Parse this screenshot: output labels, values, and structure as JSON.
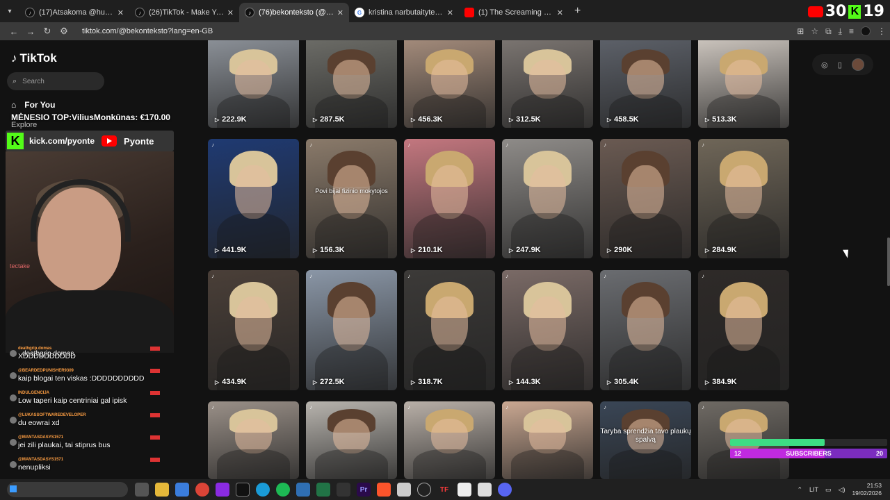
{
  "browser": {
    "tabs": [
      {
        "title": "(17)Atsakoma @hubert_0_0 #L...",
        "favicon": "tiktok-icon",
        "active": false
      },
      {
        "title": "(26)TikTok - Make Your Day",
        "favicon": "tiktok-icon",
        "active": false
      },
      {
        "title": "(76)bekonteksto (@bekontekst...",
        "favicon": "tiktok-icon",
        "active": true
      },
      {
        "title": "kristina narbutaityte - „Google\"",
        "favicon": "google-icon",
        "active": false
      },
      {
        "title": "(1) The Screaming Sheep (Origi...",
        "favicon": "youtube-icon",
        "active": false
      }
    ],
    "url": "tiktok.com/@bekonteksto?lang=en-GB"
  },
  "overlay_top": {
    "label": "30",
    "k": "K",
    "suffix": "19"
  },
  "tiktok": {
    "logo": "TikTok",
    "search_placeholder": "Search",
    "nav": {
      "for_you": "For You",
      "explore": "Explore"
    }
  },
  "videos": [
    {
      "views": "222.9K",
      "bg": "#8a8f96"
    },
    {
      "views": "287.5K",
      "bg": "#6b6b66"
    },
    {
      "views": "456.3K",
      "bg": "#a28a7a"
    },
    {
      "views": "312.5K",
      "bg": "#7a7470"
    },
    {
      "views": "458.5K",
      "bg": "#5c6068"
    },
    {
      "views": "513.3K",
      "bg": "#c9c2bb"
    },
    {
      "views": "441.9K",
      "bg": "#1f3a72"
    },
    {
      "views": "156.3K",
      "bg": "#8a7a6a",
      "caption": "Povi bijai fizinio mokytojos"
    },
    {
      "views": "210.1K",
      "bg": "#c3777f"
    },
    {
      "views": "247.9K",
      "bg": "#8e8b88"
    },
    {
      "views": "290K",
      "bg": "#6a5a52"
    },
    {
      "views": "284.9K",
      "bg": "#6f6658"
    },
    {
      "views": "434.9K",
      "bg": "#4a3f38"
    },
    {
      "views": "272.5K",
      "bg": "#8a96a6"
    },
    {
      "views": "318.7K",
      "bg": "#3c3a38"
    },
    {
      "views": "144.3K",
      "bg": "#7a6a66"
    },
    {
      "views": "305.4K",
      "bg": "#6a6c70"
    },
    {
      "views": "384.9K",
      "bg": "#2e2a28"
    },
    {
      "views": "",
      "bg": "#9a9088"
    },
    {
      "views": "",
      "bg": "#b8b4ae"
    },
    {
      "views": "",
      "bg": "#b9b0a8"
    },
    {
      "views": "",
      "bg": "#caa892"
    },
    {
      "views": "",
      "bg": "#3a4656",
      "caption": "Taryba sprendžia tavo plaukų spalvą"
    },
    {
      "views": "",
      "bg": "#6f6a64"
    }
  ],
  "stream": {
    "top_donor": "MĖNESIO TOP:ViliusMonkūnas: €170.00",
    "kick_url": "kick.com/pyonte",
    "yt_name": "Pyonte",
    "webcam_brand": "tectake",
    "chat_first": "deathgrip.domas",
    "chat": [
      {
        "user": "deathgrip.domas",
        "msg": "XDDDDDDDDDD"
      },
      {
        "user": "@BEARDEDPUNISHER9309",
        "msg": "kaip blogai ten viskas :DDDDDDDDDD"
      },
      {
        "user": "INDULGENCIJA",
        "msg": "Low taperi kaip centriniai gal ipisk"
      },
      {
        "user": "@LUKASSOFTWAREDEVELOPER",
        "msg": "du eowrai xd"
      },
      {
        "user": "@MANTASDASYS1571",
        "msg": "jei zili plaukai, tai stiprus bus"
      },
      {
        "user": "@MANTASDASYS1571",
        "msg": "nenupliksi"
      }
    ],
    "subs": {
      "current": "12",
      "label": "SUBSCRIBERS",
      "goal": "20",
      "progress": 0.6
    }
  },
  "taskbar": {
    "search_text": "",
    "lang": "LIT",
    "time": "21:53",
    "date": "19/02/2026"
  }
}
